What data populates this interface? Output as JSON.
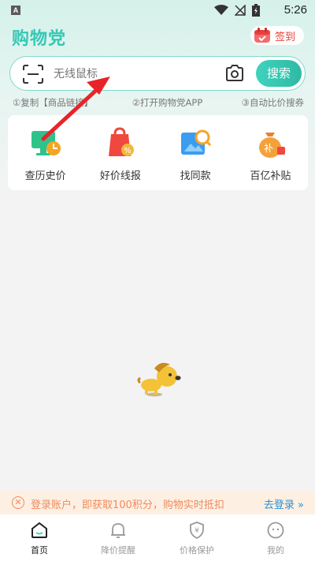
{
  "status_bar": {
    "app_badge": "A",
    "time": "5:26"
  },
  "header": {
    "title": "购物党",
    "checkin_label": "签到"
  },
  "search": {
    "placeholder": "无线鼠标",
    "button_label": "搜索"
  },
  "steps": [
    "①复制【商品链接】",
    "②打开购物党APP",
    "③自动比价搜券"
  ],
  "quick_actions": [
    {
      "label": "查历史价",
      "icon": "price-history-icon"
    },
    {
      "label": "好价线报",
      "icon": "deal-bag-icon"
    },
    {
      "label": "找同款",
      "icon": "image-search-icon"
    },
    {
      "label": "百亿补贴",
      "icon": "subsidy-bag-icon"
    }
  ],
  "login_banner": {
    "text": "登录账户，即获取100积分，购物实时抵扣",
    "link": "去登录 »"
  },
  "bottom_nav": [
    {
      "label": "首页",
      "icon": "home-icon",
      "active": true
    },
    {
      "label": "降价提醒",
      "icon": "bell-icon",
      "active": false
    },
    {
      "label": "价格保护",
      "icon": "shield-icon",
      "active": false
    },
    {
      "label": "我的",
      "icon": "profile-icon",
      "active": false
    }
  ],
  "colors": {
    "accent": "#36c8b5",
    "alert": "#e8413a",
    "banner_text": "#f08a5d",
    "link": "#2b8fd6"
  }
}
